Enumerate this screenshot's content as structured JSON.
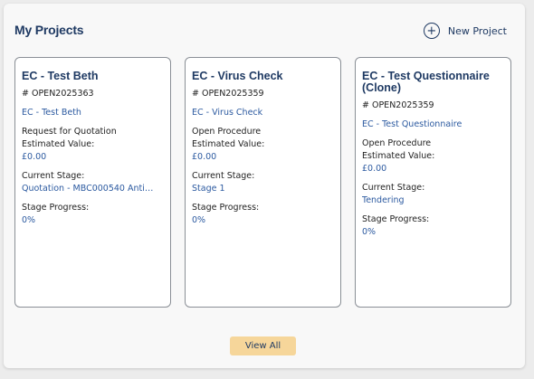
{
  "header": {
    "title": "My Projects",
    "new_project_label": "New Project",
    "new_project_icon": "plus-circle-icon"
  },
  "cards": [
    {
      "title": "EC - Test Beth",
      "ref": "# OPEN2025363",
      "link": "EC - Test Beth",
      "procedure": "Request for Quotation",
      "estimated_label": "Estimated Value:",
      "estimated_value": "£0.00",
      "stage_label": "Current Stage:",
      "stage_value": "Quotation - MBC000540 Anti…",
      "progress_label": "Stage Progress:",
      "progress_value": "0%"
    },
    {
      "title": "EC - Virus Check",
      "ref": "# OPEN2025359",
      "link": "EC - Virus Check",
      "procedure": "Open Procedure",
      "estimated_label": "Estimated Value:",
      "estimated_value": "£0.00",
      "stage_label": "Current Stage:",
      "stage_value": "Stage 1",
      "progress_label": "Stage Progress:",
      "progress_value": "0%"
    },
    {
      "title": "EC - Test Questionnaire (Clone)",
      "ref": "# OPEN2025359",
      "link": "EC - Test Questionnaire",
      "procedure": "Open Procedure",
      "estimated_label": "Estimated Value:",
      "estimated_value": "£0.00",
      "stage_label": "Current Stage:",
      "stage_value": "Tendering",
      "progress_label": "Stage Progress:",
      "progress_value": "0%"
    }
  ],
  "footer": {
    "view_all_label": "View All"
  },
  "colors": {
    "heading": "#1f3a63",
    "link": "#2c5aa0",
    "button_bg": "#f6d69a"
  }
}
